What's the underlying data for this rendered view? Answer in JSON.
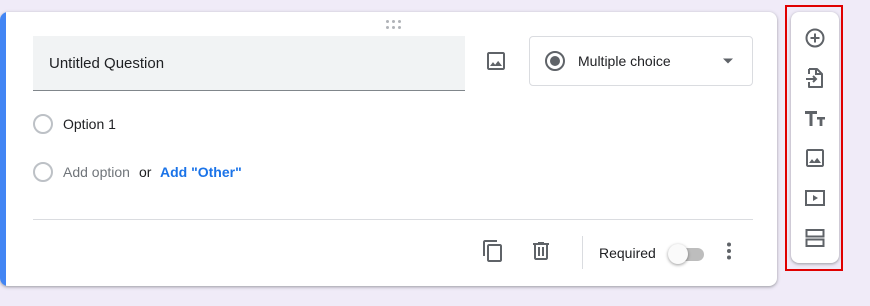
{
  "question": {
    "title": "Untitled Question",
    "type_label": "Multiple choice",
    "options": [
      {
        "label": "Option 1"
      }
    ],
    "add_option_label": "Add option",
    "or_label": "or",
    "add_other_label": "Add \"Other\"",
    "required_label": "Required",
    "required": false
  },
  "colors": {
    "accent": "#4285f4",
    "link": "#1a73e8",
    "highlight": "#e00000",
    "background": "#f0ebf8"
  },
  "icons": {
    "card": [
      "drag-handle-icon",
      "image-icon",
      "radio-checked-icon",
      "dropdown-caret-icon",
      "duplicate-icon",
      "delete-icon",
      "more-vert-icon"
    ],
    "toolbar": [
      "add-question-icon",
      "import-questions-icon",
      "add-title-icon",
      "add-image-icon",
      "add-video-icon",
      "add-section-icon"
    ]
  }
}
